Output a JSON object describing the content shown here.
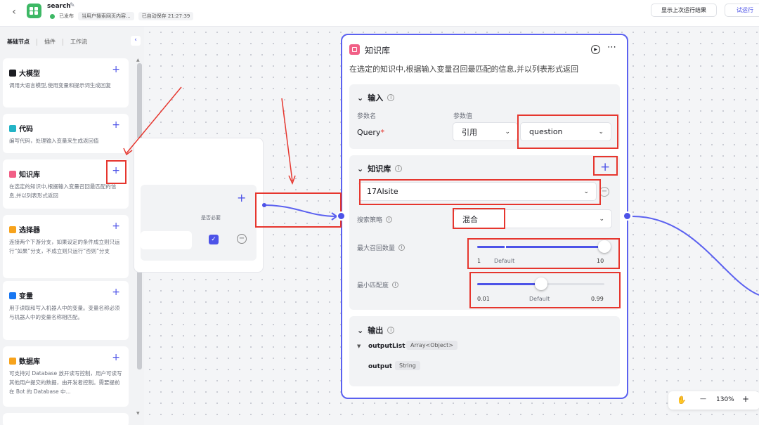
{
  "header": {
    "back_icon": "chevron-left-icon",
    "title": "search",
    "status_published": "已发布",
    "status_desc": "当用户搜索网页内容...",
    "autosave": "已自动保存 21:27:39",
    "show_last_run": "显示上次运行结果",
    "test_run": "试运行"
  },
  "sidebar": {
    "tabs": [
      "基础节点",
      "插件",
      "工作流"
    ],
    "collapse_icon": "chevron-left-icon",
    "cards": [
      {
        "name": "大模型",
        "icon": "llm-icon",
        "color": "#1c1d23",
        "desc": "调用大语言模型,使用变量和提示词生成回复"
      },
      {
        "name": "代码",
        "icon": "code-icon",
        "color": "#23b4c6",
        "desc": "编写代码，处理输入变量来生成返回值"
      },
      {
        "name": "知识库",
        "icon": "knowledge-icon",
        "color": "#f15f86",
        "desc": "在选定的知识中,根据输入变量召回最匹配的信息,并以列表形式返回"
      },
      {
        "name": "选择器",
        "icon": "condition-icon",
        "color": "#f7a31c",
        "desc": "连接两个下游分支，如果设定的条件成立则只运行“如果”分支，不成立则只运行“否则”分支"
      },
      {
        "name": "变量",
        "icon": "variable-icon",
        "color": "#1877f2",
        "desc": "用于读取和写入机器人中的变量。变量名称必须与机器人中的变量名称相匹配。"
      },
      {
        "name": "数据库",
        "icon": "database-icon",
        "color": "#f7a31c",
        "desc": "可支持对 Database 放开读写控制，用户可读写其他用户提交的数据，由开发者控制。需要提前在 Bot 的 Database 中..."
      }
    ]
  },
  "prev_node": {
    "required_label": "是否必要"
  },
  "node": {
    "title": "知识库",
    "description": "在选定的知识中,根据输入变量召回最匹配的信息,并以列表形式返回",
    "input": {
      "title": "输入",
      "col_name": "参数名",
      "col_value": "参数值",
      "param_name": "Query",
      "required_mark": "*",
      "source": "引用",
      "value": "question"
    },
    "knowledge": {
      "title": "知识库",
      "selected": "17AIsite",
      "strategy_label": "搜索策略",
      "strategy_value": "混合",
      "max_recall": {
        "label": "最大召回数量",
        "min": "1",
        "default": "Default",
        "max": "10",
        "value": 10
      },
      "min_match": {
        "label": "最小匹配度",
        "min": "0.01",
        "default": "Default",
        "max": "0.99",
        "value": 0.5
      }
    },
    "output": {
      "title": "输出",
      "items": [
        {
          "name": "outputList",
          "type": "Array<Object>"
        },
        {
          "name": "output",
          "type": "String"
        }
      ]
    }
  },
  "zoom": {
    "hand_icon": "hand-icon",
    "minus": "—",
    "level": "130%",
    "plus": "+"
  }
}
